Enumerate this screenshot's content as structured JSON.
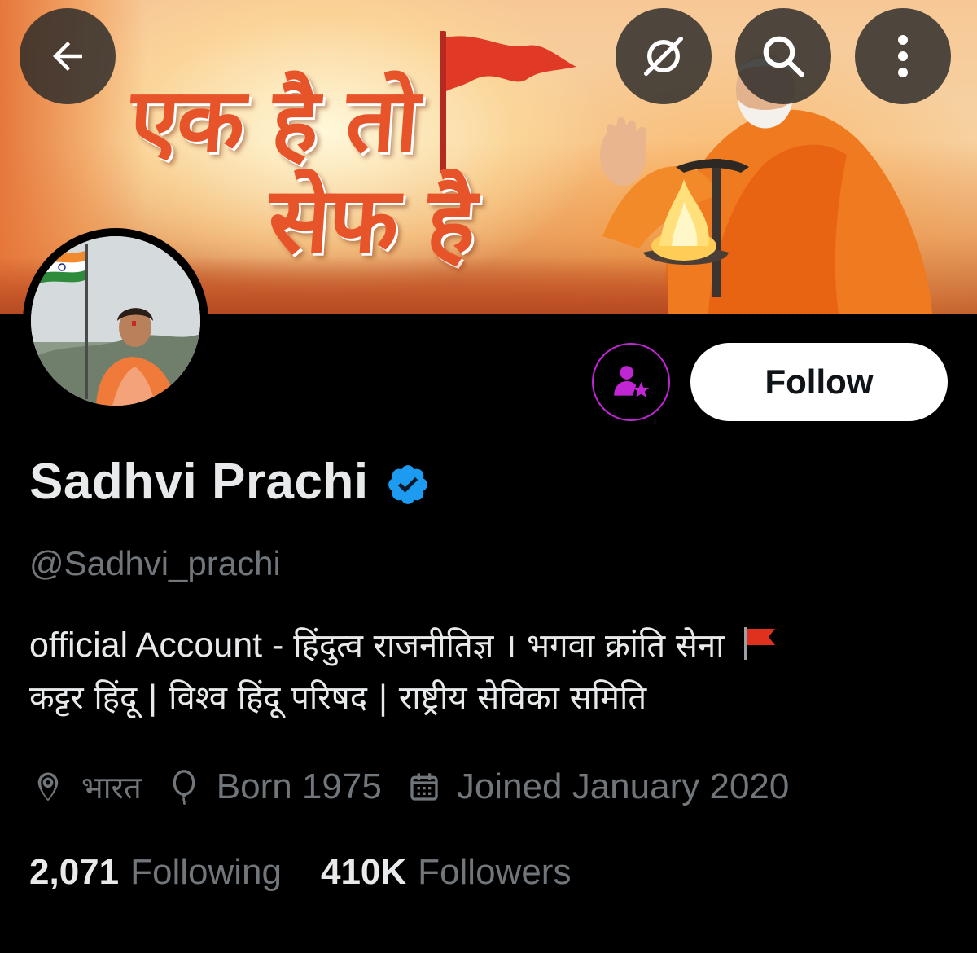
{
  "banner": {
    "line1": "एक है तो",
    "line2": "सेफ है"
  },
  "actions": {
    "follow_label": "Follow"
  },
  "profile": {
    "display_name": "Sadhvi Prachi",
    "handle": "@Sadhvi_prachi",
    "bio_line1_latin": "official Account - ",
    "bio_line1_devanagari": "हिंदुत्व राजनीतिज्ञ । भगवा क्रांति सेना",
    "bio_line2": "कट्टर हिंदू | विश्व हिंदू परिषद | राष्ट्रीय सेविका समिति",
    "location": "भारत",
    "birth": "Born 1975",
    "joined": "Joined January 2020"
  },
  "stats": {
    "following_count": "2,071",
    "following_label": "Following",
    "followers_count": "410K",
    "followers_label": "Followers"
  },
  "icons": {
    "back": "arrow-left-icon",
    "grok": "grok-icon",
    "search": "search-icon",
    "more": "more-vertical-icon",
    "subscribe": "person-star-icon",
    "verified": "verified-badge-icon",
    "location": "location-pin-icon",
    "birth": "balloon-icon",
    "calendar": "calendar-icon",
    "bio_flag": "red-flag-emoji"
  },
  "colors": {
    "verified_blue": "#1d9bf0",
    "subscribe_purple": "#c026d3",
    "muted_text": "#71767b",
    "banner_text": "#e8542a"
  }
}
